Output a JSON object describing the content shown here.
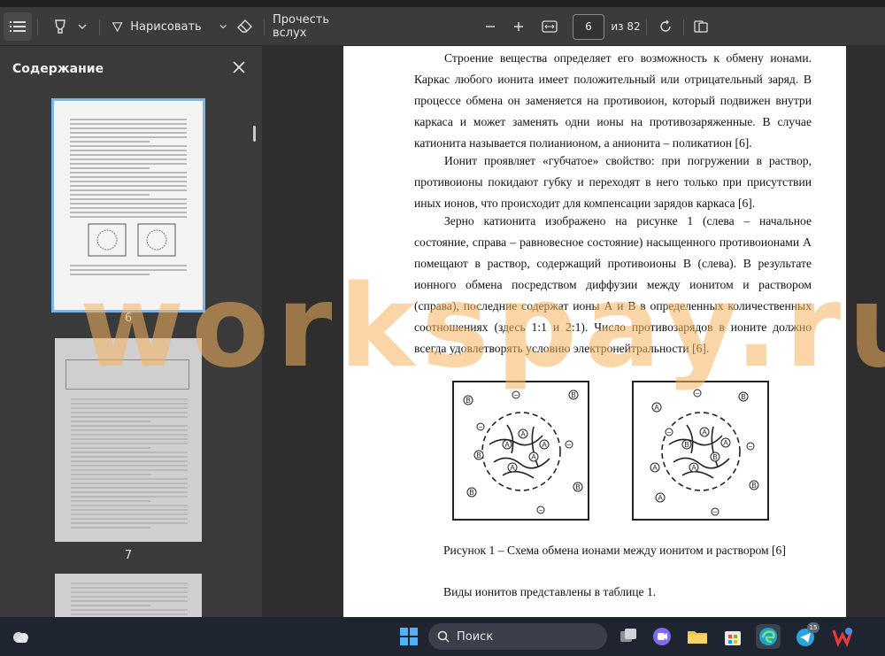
{
  "toolbar": {
    "draw_label": "Нарисовать",
    "read_aloud_label": "Прочесть вслух",
    "page_current": "6",
    "page_total": "из 82"
  },
  "sidebar": {
    "title": "Содержание",
    "thumbnails": [
      {
        "page": "6",
        "selected": true
      },
      {
        "page": "7",
        "selected": false
      }
    ]
  },
  "document": {
    "paragraphs": [
      "Строение вещества определяет его возможность к обмену ионами. Каркас любого ионита имеет положительный или отрицательный заряд. В процессе обмена он заменяется на противоион, который подвижен внутри каркаса и может заменять одни ионы на противозаряженные. В случае катионита называется полианионом, а анионита – поликатион [6].",
      "Ионит проявляет «губчатое» свойство: при погружении в раствор, противоионы покидают губку и переходят в него только при присутствии иных ионов, что происходит для компенсации зарядов каркаса [6].",
      "Зерно катионита изображено на рисунке 1 (слева – начальное состояние, справа – равновесное состояние) насыщенного противоионами А помещают в раствор, содержащий противоионы В (слева). В результате ионного обмена посредством диффузии между ионитом и раствором (справа), последние содержат ионы А и В в определенных количественных соотношениях (здесь 1:1 и 2:1). Число противозарядов в ионите должно всегда удовлетворять условию электронейтральности [6]."
    ],
    "figure_caption": "Рисунок 1 – Схема обмена ионами между ионитом и раствором [6]",
    "tail_text": "Виды ионитов представлены в таблице 1."
  },
  "watermark": "workspay.ru",
  "taskbar": {
    "search_label": "Поиск",
    "telegram_badge": "15"
  },
  "colors": {
    "toolbar_bg": "#3b3b3b",
    "sidebar_bg": "#3a3a3a",
    "selection": "#7fb6e9",
    "watermark": "#f5b25f",
    "taskbar_bg": "#1f2530"
  }
}
